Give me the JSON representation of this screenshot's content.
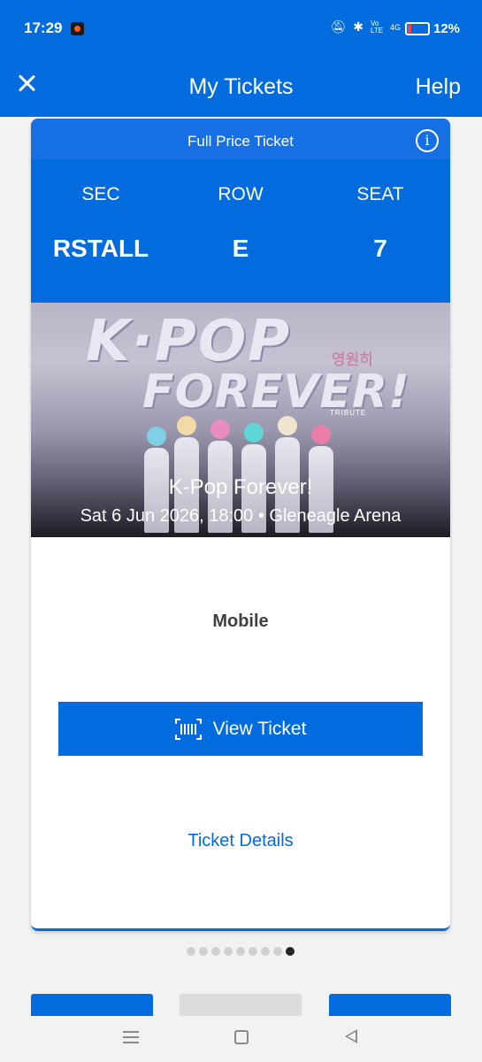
{
  "status_bar": {
    "time": "17:29",
    "icons": [
      "mute-icon",
      "bluetooth-icon",
      "volte-icon",
      "signal-4g-icon",
      "battery-icon"
    ],
    "volte": "Vo LTE",
    "network": "4G",
    "battery_percent": "12%"
  },
  "header": {
    "title": "My Tickets",
    "help_label": "Help"
  },
  "ticket": {
    "type_label": "Full Price Ticket",
    "sec_label": "SEC",
    "sec_value": "RSTALL",
    "row_label": "ROW",
    "row_value": "E",
    "seat_label": "SEAT",
    "seat_value": "7",
    "banner": {
      "logo_line1": "K·POP",
      "logo_line2": "FOREVER!",
      "korean_text": "영원히",
      "tribute_text": "TRIBUTE"
    },
    "event_title": "K-Pop Forever!",
    "event_subtitle": "Sat 6 Jun 2026, 18:00 • Gleneagle Arena",
    "delivery_method": "Mobile",
    "view_ticket_label": "View Ticket",
    "details_link_label": "Ticket Details"
  },
  "pager": {
    "total": 9,
    "active_index": 8
  },
  "colors": {
    "brand_blue": "#026cdf",
    "background": "#f2f2f2",
    "disabled_gray": "#dcdcdc"
  }
}
